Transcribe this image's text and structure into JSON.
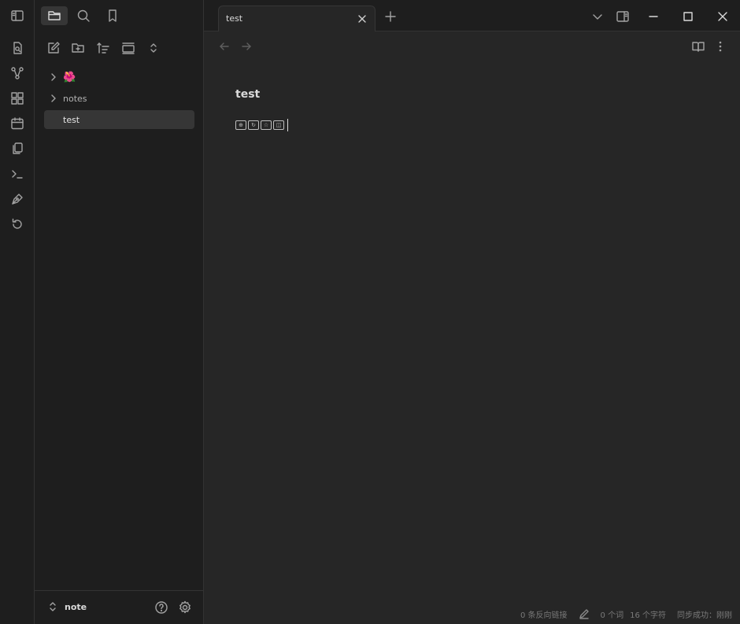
{
  "explorer": {
    "tree": [
      {
        "label": "🌺",
        "type": "folder",
        "collapsed": true
      },
      {
        "label": "notes",
        "type": "folder",
        "collapsed": true
      },
      {
        "label": "test",
        "type": "file",
        "active": true
      }
    ],
    "vault_name": "note"
  },
  "tabs": [
    {
      "title": "test",
      "active": true
    }
  ],
  "editor": {
    "title": "test",
    "body_symbols": [
      "⊕",
      "↻",
      "☆",
      "◫"
    ]
  },
  "status": {
    "backlinks": "0 条反向链接",
    "words": "0 个词",
    "chars": "16 个字符",
    "sync": "同步成功：刚刚"
  },
  "colors": {
    "background": "#262626",
    "sidebar": "#1e1e1e",
    "active_item": "#363636",
    "icon": "#a3a3a3",
    "text": "#dadada"
  }
}
